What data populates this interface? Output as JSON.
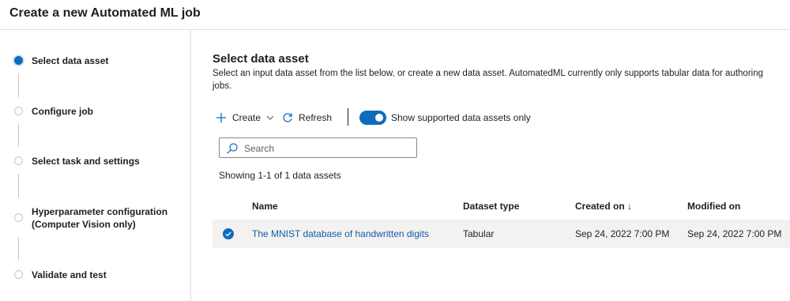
{
  "header": {
    "title": "Create a new Automated ML job"
  },
  "sidebar": {
    "steps": [
      {
        "label": "Select data asset",
        "state": "active"
      },
      {
        "label": "Configure job",
        "state": "pending"
      },
      {
        "label": "Select task and settings",
        "state": "pending"
      },
      {
        "label": "Hyperparameter configuration",
        "label2": "(Computer Vision only)",
        "state": "pending"
      },
      {
        "label": "Validate and test",
        "state": "pending"
      }
    ]
  },
  "main": {
    "title": "Select data asset",
    "description": "Select an input data asset from the list below, or create a new data asset. AutomatedML currently only supports tabular data for authoring jobs.",
    "toolbar": {
      "create_label": "Create",
      "refresh_label": "Refresh",
      "toggle_label": "Show supported data assets only",
      "toggle_on": true
    },
    "search": {
      "placeholder": "Search"
    },
    "showing_text": "Showing 1-1 of 1 data assets",
    "table": {
      "columns": [
        "Name",
        "Dataset type",
        "Created on ↓",
        "Modified on"
      ],
      "rows": [
        {
          "selected": true,
          "name": "The MNIST database of handwritten digits",
          "type": "Tabular",
          "created": "Sep 24, 2022 7:00 PM",
          "modified": "Sep 24, 2022 7:00 PM"
        }
      ]
    }
  },
  "colors": {
    "accent": "#0f6cbd",
    "link": "#0f5da8",
    "row_selected_bg": "#f3f2f1"
  },
  "icons": [
    "plus-icon",
    "chevron-down-icon",
    "refresh-icon",
    "search-icon",
    "check-circle-icon"
  ]
}
